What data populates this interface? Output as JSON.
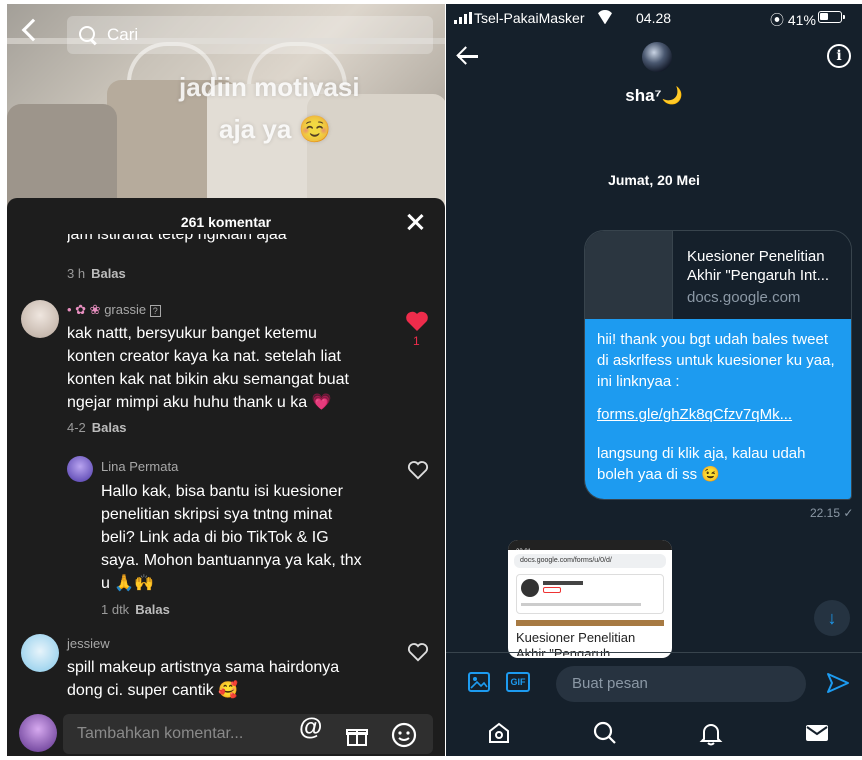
{
  "tiktok": {
    "search_placeholder": "Cari",
    "video_overlay_line1": "jadiin motivasi",
    "video_overlay_line2": "aja ya ☺️",
    "comments_title": "261 komentar",
    "comments": [
      {
        "text": "jam istirahat tetep ngikiain ajaa",
        "time": "3 h",
        "reply": "Balas"
      },
      {
        "username": "grassie",
        "text_lines": [
          "kak nattt, bersyukur banget ketemu",
          "konten creator kaya ka nat. setelah liat",
          "konten kak nat bikin aku semangat buat",
          "ngejar mimpi aku huhu thank u ka 💗"
        ],
        "time": "4-2",
        "reply": "Balas",
        "likes": "1"
      },
      {
        "username": "Lina Permata",
        "text_lines": [
          "Hallo kak, bisa bantu isi kuesioner",
          "penelitian skripsi sya tntng minat",
          "beli? Link ada di bio TikTok & IG",
          "saya. Mohon bantuannya ya kak, thx",
          "u 🙏🙌"
        ],
        "time": "1 dtk",
        "reply": "Balas"
      },
      {
        "username": "jessiew",
        "text_lines": [
          "spill makeup artistnya sama hairdonya",
          "dong ci. super cantik 🥰"
        ]
      }
    ],
    "add_comment_placeholder": "Tambahkan komentar...",
    "input_icons": [
      "at-icon",
      "gift-icon",
      "emoji-icon"
    ]
  },
  "twitter": {
    "status": {
      "carrier": "Tsel-PakaiMasker",
      "time": "04.28",
      "battery": "41%"
    },
    "dm_name": "sha⁷🌙",
    "date_separator": "Jumat, 20 Mei",
    "link_card": {
      "title": "Kuesioner Penelitian Akhir \"Pengaruh Int...",
      "domain": "docs.google.com"
    },
    "message": {
      "text": "hii! thank you bgt udah bales tweet di askrlfess untuk kuesioner ku yaa, ini linknyaa :",
      "link": "forms.gle/ghZk8qCfzv7qMk...",
      "tail": "langsung di klik aja, kalau udah boleh yaa di ss 😉",
      "time": "22.15 ✓"
    },
    "screenshot_preview": {
      "status_time": "23.01",
      "url": "docs.google.com/forms/u/0/d/",
      "title": "Kuesioner Penelitian Akhir \"Pengaruh"
    },
    "composer_placeholder": "Buat pesan",
    "gif_label": "GIF",
    "nav": [
      "home-icon",
      "search-icon",
      "notifications-icon",
      "messages-icon"
    ],
    "colors": {
      "accent": "#1d9bf0",
      "background": "#15202b",
      "tiktok_like": "#ee2c4b"
    }
  }
}
